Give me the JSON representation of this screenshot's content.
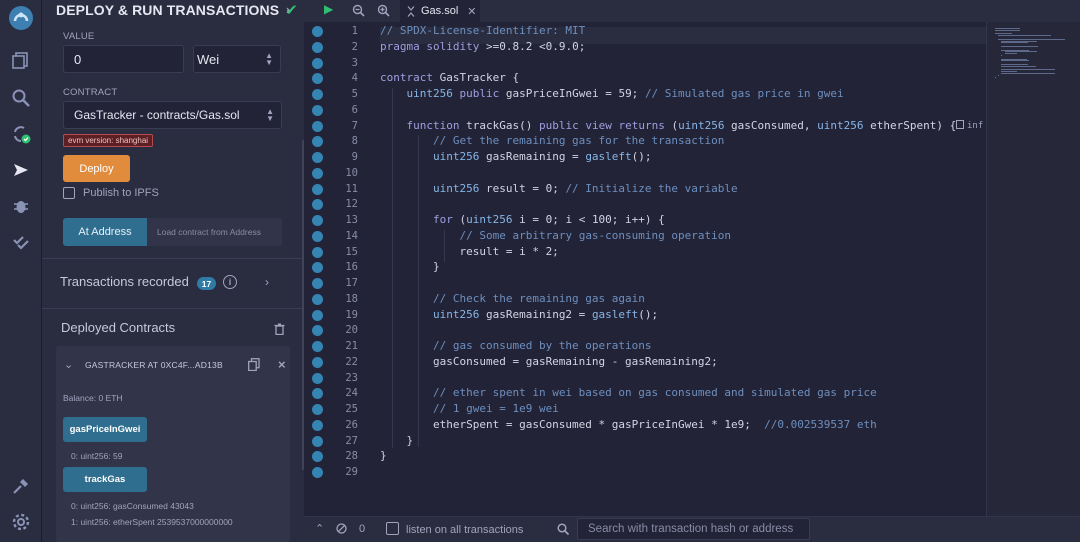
{
  "panel": {
    "title": "DEPLOY & RUN TRANSACTIONS",
    "value_label": "VALUE",
    "value_input": "0",
    "unit_select": "Wei",
    "contract_label": "CONTRACT",
    "contract_select": "GasTracker - contracts/Gas.sol",
    "evm_badge": "evm version: shanghai",
    "deploy_label": "Deploy",
    "publish_label": "Publish to IPFS",
    "at_address_label": "At Address",
    "load_contract_placeholder": "Load contract from Address",
    "transactions_recorded": "Transactions recorded",
    "transactions_count": "17",
    "deployed_contracts": "Deployed Contracts",
    "instance_title": "GASTRACKER AT 0XC4F...AD13B",
    "balance": "Balance: 0 ETH",
    "fn1_label": "gasPriceInGwei",
    "fn1_result": "0: uint256: 59",
    "fn2_label": "trackGas",
    "fn2_result0": "0: uint256: gasConsumed 43043",
    "fn2_result1": "1: uint256: etherSpent 2539537000000000"
  },
  "editor": {
    "tab_name": "Gas.sol",
    "info_hint": "inf",
    "lines": [
      "// SPDX-License-Identifier: MIT",
      "pragma solidity >=0.8.2 <0.9.0;",
      "",
      "contract GasTracker {",
      "    uint256 public gasPriceInGwei = 59; // Simulated gas price in gwei",
      "",
      "    function trackGas() public view returns (uint256 gasConsumed, uint256 etherSpent) {",
      "        // Get the remaining gas for the transaction",
      "        uint256 gasRemaining = gasleft();",
      "",
      "        uint256 result = 0; // Initialize the variable",
      "",
      "        for (uint256 i = 0; i < 100; i++) {",
      "            // Some arbitrary gas-consuming operation",
      "            result = i * 2;",
      "        }",
      "",
      "        // Check the remaining gas again",
      "        uint256 gasRemaining2 = gasleft();",
      "",
      "        // gas consumed by the operations",
      "        gasConsumed = gasRemaining - gasRemaining2;",
      "",
      "        // ether spent in wei based on gas consumed and simulated gas price",
      "        // 1 gwei = 1e9 wei",
      "        etherSpent = gasConsumed * gasPriceInGwei * 1e9;  //0.002539537 eth",
      "    }",
      "}",
      ""
    ]
  },
  "terminal": {
    "count": "0",
    "listen_label": "listen on all transactions",
    "search_placeholder": "Search with transaction hash or address"
  },
  "colors": {
    "accent": "#306e8f",
    "deploy": "#e18b3c",
    "background": "#222336"
  }
}
